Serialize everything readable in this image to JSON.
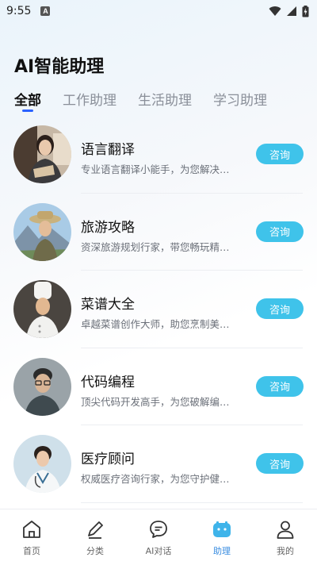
{
  "status": {
    "time": "9:55",
    "badge": "A"
  },
  "page": {
    "title": "AI智能助理"
  },
  "tabs": [
    {
      "label": "全部",
      "active": true
    },
    {
      "label": "工作助理",
      "active": false
    },
    {
      "label": "生活助理",
      "active": false
    },
    {
      "label": "学习助理",
      "active": false
    }
  ],
  "assistants": [
    {
      "name": "语言翻译",
      "desc": "专业语言翻译小能手，为您解决…",
      "button": "咨询"
    },
    {
      "name": "旅游攻略",
      "desc": "资深旅游规划行家，带您畅玩精…",
      "button": "咨询"
    },
    {
      "name": "菜谱大全",
      "desc": "卓越菜谱创作大师，助您烹制美…",
      "button": "咨询"
    },
    {
      "name": "代码编程",
      "desc": "顶尖代码开发高手，为您破解编…",
      "button": "咨询"
    },
    {
      "name": "医疗顾问",
      "desc": "权威医疗咨询行家，为您守护健…",
      "button": "咨询"
    }
  ],
  "nav": [
    {
      "label": "首页",
      "icon": "home-icon",
      "active": false
    },
    {
      "label": "分类",
      "icon": "pencil-icon",
      "active": false
    },
    {
      "label": "AI对话",
      "icon": "chat-bubble-icon",
      "active": false
    },
    {
      "label": "助理",
      "icon": "robot-icon",
      "active": true
    },
    {
      "label": "我的",
      "icon": "user-icon",
      "active": false
    }
  ],
  "colors": {
    "accent": "#3fc3ea",
    "tab_indicator": "#2a62ff",
    "nav_active": "#3a8de0"
  }
}
